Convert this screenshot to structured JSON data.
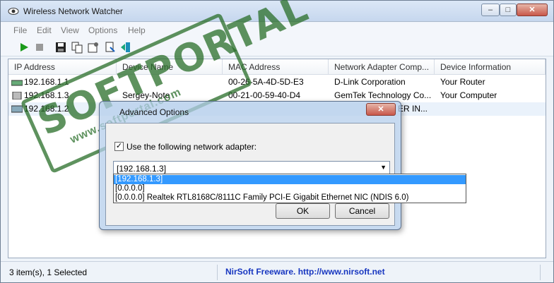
{
  "window": {
    "title": "Wireless Network Watcher",
    "min": "–",
    "max": "□",
    "close": "✕"
  },
  "menu": [
    "File",
    "Edit",
    "View",
    "Options",
    "Help"
  ],
  "toolbar": {
    "icons": [
      "play-icon",
      "stop-icon",
      "save-icon",
      "copy-icon",
      "properties-icon",
      "refresh-icon",
      "exit-icon"
    ]
  },
  "list": {
    "columns": [
      "IP Address",
      "Device Name",
      "MAC Address",
      "Network Adapter Comp...",
      "Device Information"
    ],
    "rows": [
      {
        "ip": "192.168.1.1",
        "name": "",
        "mac": "00-26-5A-4D-5D-E3",
        "adapter": "D-Link Corporation",
        "info": "Your Router"
      },
      {
        "ip": "192.168.1.3",
        "name": "Sergey-Note",
        "mac": "00-21-00-59-40-D4",
        "adapter": "GemTek Technology Co...",
        "info": "Your Computer"
      },
      {
        "ip": "192.168.1.2",
        "name": "",
        "mac": "",
        "adapter": "ER IN...",
        "info": ""
      }
    ]
  },
  "status": {
    "count": "3 item(s), 1 Selected",
    "link": "NirSoft Freeware.  http://www.nirsoft.net"
  },
  "dialog": {
    "title": "Advanced Options",
    "close": "✕",
    "checkbox_label": "Use the following network adapter:",
    "checkbox_mark": "✓",
    "combo_value": "[192.168.1.3]",
    "combo_arrow": "▼",
    "options": [
      "[192.168.1.3]",
      "[0.0.0.0]",
      "[0.0.0.0]  Realtek RTL8168C/8111C Family PCI-E Gigabit Ethernet NIC (NDIS 6.0)"
    ],
    "ok": "OK",
    "cancel": "Cancel"
  },
  "watermark": {
    "text": "SOFTPORTAL",
    "url": "www.softportal.com",
    "tm": "™"
  },
  "colors": {
    "link": "#1736c0",
    "selection": "#3399ff",
    "stamp": "#2e6e2e"
  }
}
